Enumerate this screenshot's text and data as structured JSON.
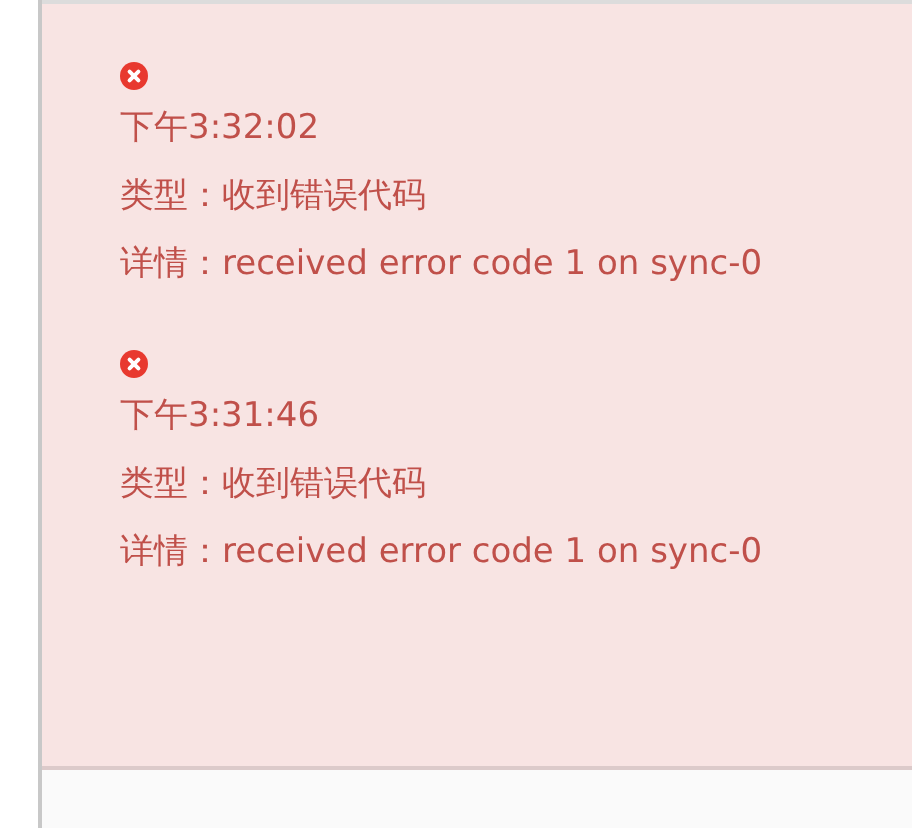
{
  "log_entries": [
    {
      "kind": "error",
      "time": "下午3:32:02",
      "type": "类型：收到错误代码",
      "detail": "详情：received error code 1 on sync-0"
    },
    {
      "kind": "error",
      "time": "下午3:31:46",
      "type": "类型：收到错误代码",
      "detail": "详情：received error code 1 on sync-0"
    }
  ]
}
